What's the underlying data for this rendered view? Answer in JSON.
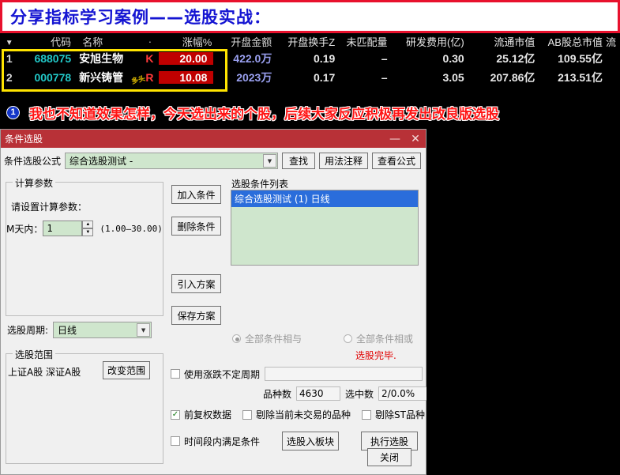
{
  "banner": {
    "title": "分享指标学习案例——选股实战："
  },
  "quote": {
    "columns": [
      "",
      "代码",
      "名称",
      "·",
      "涨幅%",
      "开盘金额",
      "开盘换手Z",
      "未匹配量",
      "研发费用(亿)",
      "流通市值",
      "AB股总市值",
      "流"
    ],
    "sort_arrow": "▼",
    "rows": [
      {
        "index": "1",
        "code": "688075",
        "name": "安旭生物",
        "tag": "",
        "flag": "K",
        "change": "20.00",
        "amount": "422.0万",
        "turnover": "0.19",
        "unmatched": "–",
        "rd": "0.30",
        "float_cap": "25.12亿",
        "ab_cap": "109.55亿"
      },
      {
        "index": "2",
        "code": "000778",
        "name": "新兴铸管",
        "tag": "多头",
        "flag": "R",
        "change": "10.08",
        "amount": "2023万",
        "turnover": "0.17",
        "unmatched": "–",
        "rd": "3.05",
        "float_cap": "207.86亿",
        "ab_cap": "213.51亿"
      }
    ]
  },
  "caption": {
    "badge": "1",
    "text": "我也不知道效果怎样，今天选出来的个股，后续大家反应积极再发出改良版选股"
  },
  "dialog": {
    "title": "条件选股",
    "minimize": "—",
    "close": "✕",
    "formula": {
      "label": "条件选股公式",
      "value": "综合选股测试 -",
      "find_button": "查找",
      "usage_button": "用法注释",
      "view_button": "查看公式"
    },
    "calc_group": {
      "title": "计算参数",
      "prompt": "请设置计算参数：",
      "param_label": "M天内：",
      "param_value": "1",
      "param_range": "(1.00—30.00)"
    },
    "action_buttons": {
      "add": "加入条件",
      "remove": "删除条件",
      "import": "引入方案",
      "save": "保存方案"
    },
    "condition_list": {
      "title": "选股条件列表",
      "items": [
        "综合选股测试 (1) 日线"
      ]
    },
    "logic": {
      "and_label": "全部条件相与",
      "or_label": "全部条件相或",
      "selected": "and"
    },
    "status": "选股完毕.",
    "period": {
      "label": "选股周期:",
      "value": "日线"
    },
    "scope": {
      "title": "选股范围",
      "value": "上证A股 深证A股",
      "change_button": "改变范围"
    },
    "options": {
      "unstable_period": "使用涨跌不定周期",
      "unstable_value": "",
      "count_label": "品种数",
      "count_value": "4630",
      "selected_label": "选中数",
      "selected_value": "2/0.0%",
      "adjusted_data": "前复权数据",
      "exclude_untraded": "剔除当前未交易的品种",
      "exclude_st": "剔除ST品种",
      "period_satisfy": "时间段内满足条件"
    },
    "bottom_buttons": {
      "to_block": "选股入板块",
      "execute": "执行选股",
      "close": "关闭"
    }
  },
  "colors": {
    "banner_border": "#e8112d",
    "banner_text": "#1414d2",
    "title_bar": "#b83137",
    "highlight_box": "#ffe400",
    "up_red": "#c00000",
    "caption_red": "#ff1414",
    "combo_green": "#cfe6cd",
    "list_select": "#2a6ddb"
  }
}
